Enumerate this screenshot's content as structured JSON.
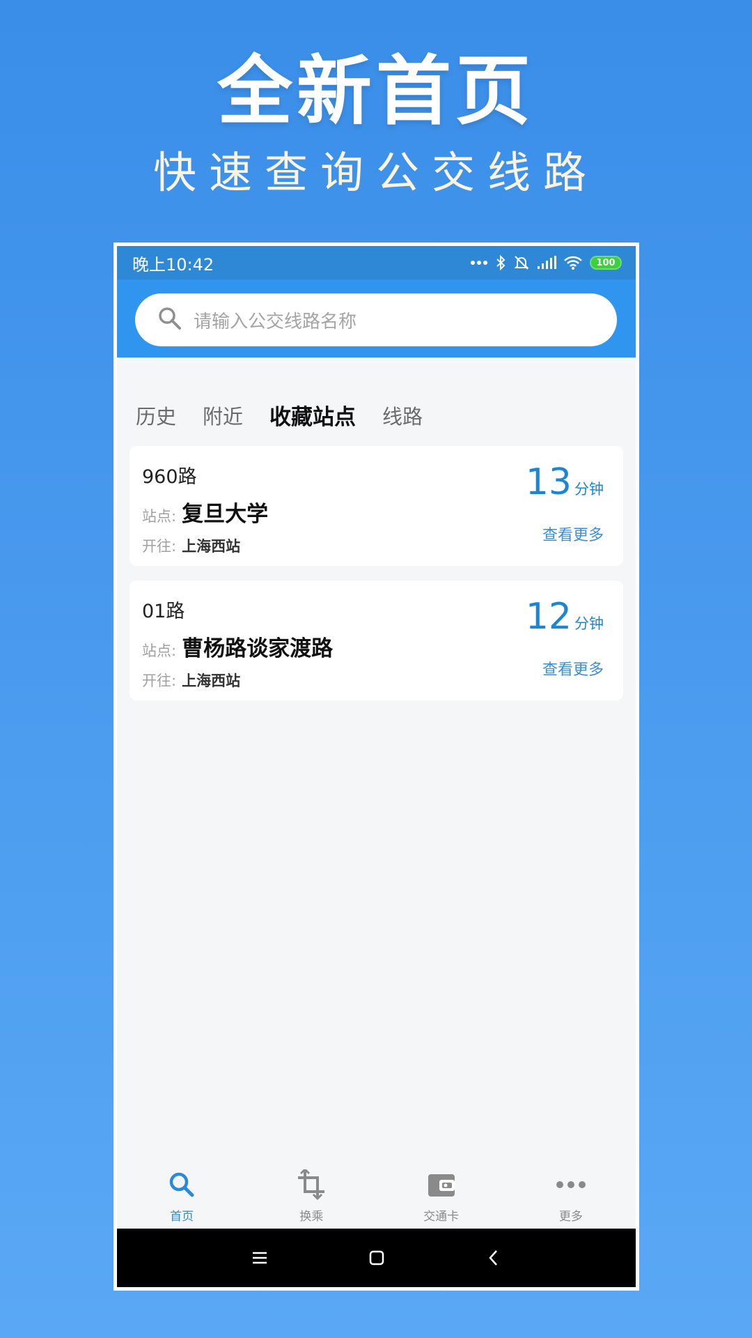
{
  "promo": {
    "title": "全新首页",
    "subtitle": "快速查询公交线路"
  },
  "status_bar": {
    "time": "晚上10:42",
    "battery": "100",
    "icons": [
      "more-dots-icon",
      "bluetooth-icon",
      "mute-icon",
      "signal-icon",
      "wifi-icon",
      "battery-icon"
    ]
  },
  "search": {
    "placeholder": "请输入公交线路名称"
  },
  "tabs": [
    {
      "label": "历史",
      "active": false
    },
    {
      "label": "附近",
      "active": false
    },
    {
      "label": "收藏站点",
      "active": true
    },
    {
      "label": "线路",
      "active": false
    }
  ],
  "cards": [
    {
      "route": "960路",
      "station_label": "站点:",
      "station": "复旦大学",
      "dest_label": "开往:",
      "dest": "上海西站",
      "eta": "13",
      "eta_unit": "分钟",
      "more": "查看更多"
    },
    {
      "route": "01路",
      "station_label": "站点:",
      "station": "曹杨路谈家渡路",
      "dest_label": "开往:",
      "dest": "上海西站",
      "eta": "12",
      "eta_unit": "分钟",
      "more": "查看更多"
    }
  ],
  "bottom_nav": [
    {
      "label": "首页",
      "icon": "search-icon",
      "active": true
    },
    {
      "label": "换乘",
      "icon": "transfer-icon",
      "active": false
    },
    {
      "label": "交通卡",
      "icon": "wallet-icon",
      "active": false
    },
    {
      "label": "更多",
      "icon": "more-icon",
      "active": false
    }
  ],
  "colors": {
    "background": "#3a8ee8",
    "status_bar": "#2e88d6",
    "search_bar": "#2f95ee",
    "accent": "#1d86d0",
    "battery": "#3ecf3e"
  }
}
